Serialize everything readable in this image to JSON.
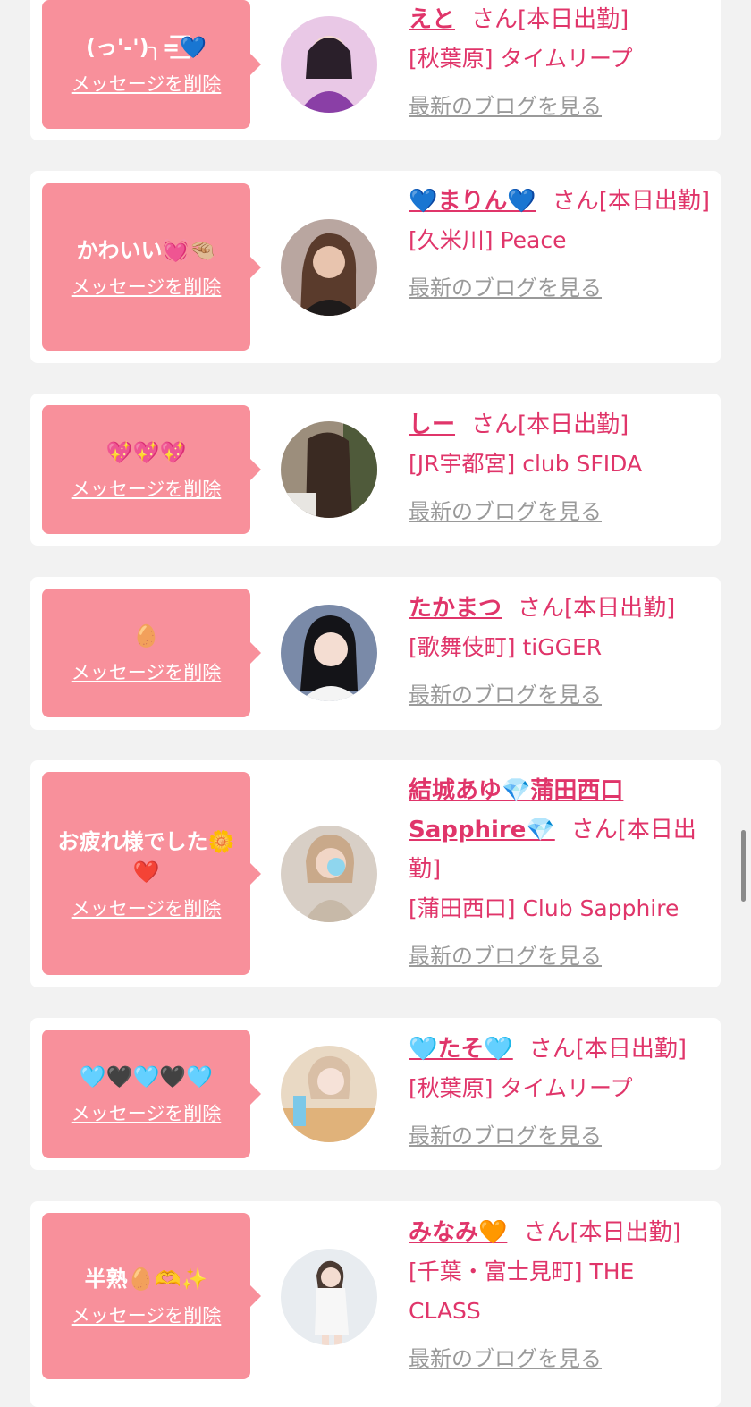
{
  "labels": {
    "delete": "メッセージを削除",
    "blog": "最新のブログを見る",
    "san": "さん[本日出勤]"
  },
  "entries": [
    {
      "message": "(っ'-')╮=͟͟͞͞💙",
      "name": "えと",
      "shop": "[秋葉原] タイムリープ"
    },
    {
      "message": "かわいい💓🤏🏼",
      "name": "💙まりん💙",
      "shop": "[久米川] Peace"
    },
    {
      "message": "💖💖💖",
      "name": "しー",
      "shop": "[JR宇都宮] club SFIDA"
    },
    {
      "message": "🥚",
      "name": "たかまつ",
      "shop": "[歌舞伎町] tiGGER"
    },
    {
      "message": "お疲れ様でした🌼\n❤️",
      "name": "結城あゆ💎蒲田西口Sapphire💎",
      "shop": "[蒲田西口] Club Sapphire"
    },
    {
      "message": "🩵🖤🩵🖤🩵",
      "name": "🩵たそ🩵",
      "shop": "[秋葉原] タイムリープ"
    },
    {
      "message": "半熟🥚🫶✨",
      "name": "みなみ🧡",
      "shop": "[千葉・富士見町] THE CLASS"
    }
  ],
  "colors": {
    "accent": "#e0356a",
    "bubble": "#f8909b",
    "muted": "#9a9a9a",
    "background": "#f2f2f2"
  }
}
